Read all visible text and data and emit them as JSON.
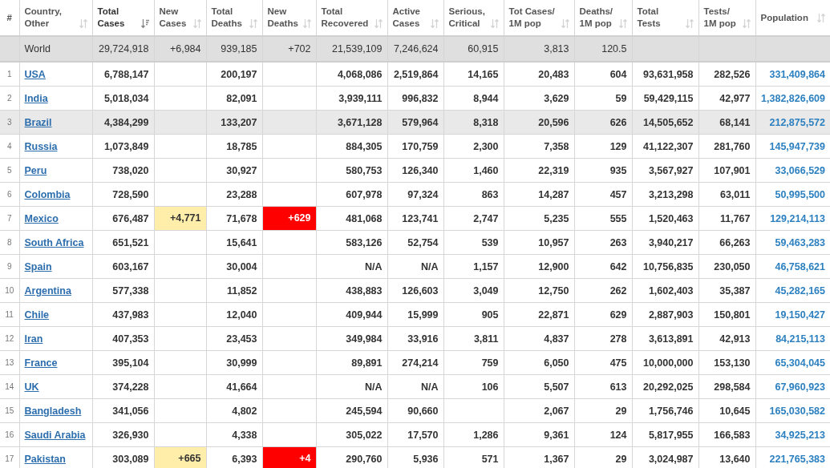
{
  "table": {
    "columns": [
      {
        "label": "#",
        "sortable": false,
        "sorted": false
      },
      {
        "label": "Country,\nOther",
        "sortable": true,
        "sorted": false
      },
      {
        "label": "Total\nCases",
        "sortable": true,
        "sorted": true
      },
      {
        "label": "New\nCases",
        "sortable": true,
        "sorted": false
      },
      {
        "label": "Total\nDeaths",
        "sortable": true,
        "sorted": false
      },
      {
        "label": "New\nDeaths",
        "sortable": true,
        "sorted": false
      },
      {
        "label": "Total\nRecovered",
        "sortable": true,
        "sorted": false
      },
      {
        "label": "Active\nCases",
        "sortable": true,
        "sorted": false
      },
      {
        "label": "Serious,\nCritical",
        "sortable": true,
        "sorted": false
      },
      {
        "label": "Tot Cases/\n1M pop",
        "sortable": true,
        "sorted": false
      },
      {
        "label": "Deaths/\n1M pop",
        "sortable": true,
        "sorted": false
      },
      {
        "label": "Total\nTests",
        "sortable": true,
        "sorted": false
      },
      {
        "label": "Tests/\n1M pop",
        "sortable": true,
        "sorted": false
      },
      {
        "label": "Population",
        "sortable": true,
        "sorted": false
      }
    ],
    "total": {
      "cells": [
        null,
        "World",
        "29,724,918",
        "+6,984",
        "939,185",
        "+702",
        "21,539,109",
        "7,246,624",
        "60,915",
        "3,813",
        "120.5",
        null,
        null,
        null
      ]
    },
    "rows": [
      {
        "highlighted": false,
        "cells": [
          "1",
          "USA",
          "6,788,147",
          null,
          "200,197",
          null,
          "4,068,086",
          "2,519,864",
          "14,165",
          "20,483",
          "604",
          "93,631,958",
          "282,526",
          "331,409,864"
        ]
      },
      {
        "highlighted": false,
        "cells": [
          "2",
          "India",
          "5,018,034",
          null,
          "82,091",
          null,
          "3,939,111",
          "996,832",
          "8,944",
          "3,629",
          "59",
          "59,429,115",
          "42,977",
          "1,382,826,609"
        ]
      },
      {
        "highlighted": true,
        "cells": [
          "3",
          "Brazil",
          "4,384,299",
          null,
          "133,207",
          null,
          "3,671,128",
          "579,964",
          "8,318",
          "20,596",
          "626",
          "14,505,652",
          "68,141",
          "212,875,572"
        ]
      },
      {
        "highlighted": false,
        "cells": [
          "4",
          "Russia",
          "1,073,849",
          null,
          "18,785",
          null,
          "884,305",
          "170,759",
          "2,300",
          "7,358",
          "129",
          "41,122,307",
          "281,760",
          "145,947,739"
        ]
      },
      {
        "highlighted": false,
        "cells": [
          "5",
          "Peru",
          "738,020",
          null,
          "30,927",
          null,
          "580,753",
          "126,340",
          "1,460",
          "22,319",
          "935",
          "3,567,927",
          "107,901",
          "33,066,529"
        ]
      },
      {
        "highlighted": false,
        "cells": [
          "6",
          "Colombia",
          "728,590",
          null,
          "23,288",
          null,
          "607,978",
          "97,324",
          "863",
          "14,287",
          "457",
          "3,213,298",
          "63,011",
          "50,995,500"
        ]
      },
      {
        "highlighted": false,
        "cells": [
          "7",
          "Mexico",
          "676,487",
          "+4,771",
          "71,678",
          "+629",
          "481,068",
          "123,741",
          "2,747",
          "5,235",
          "555",
          "1,520,463",
          "11,767",
          "129,214,113"
        ]
      },
      {
        "highlighted": false,
        "cells": [
          "8",
          "South Africa",
          "651,521",
          null,
          "15,641",
          null,
          "583,126",
          "52,754",
          "539",
          "10,957",
          "263",
          "3,940,217",
          "66,263",
          "59,463,283"
        ]
      },
      {
        "highlighted": false,
        "cells": [
          "9",
          "Spain",
          "603,167",
          null,
          "30,004",
          null,
          "N/A",
          "N/A",
          "1,157",
          "12,900",
          "642",
          "10,756,835",
          "230,050",
          "46,758,621"
        ]
      },
      {
        "highlighted": false,
        "cells": [
          "10",
          "Argentina",
          "577,338",
          null,
          "11,852",
          null,
          "438,883",
          "126,603",
          "3,049",
          "12,750",
          "262",
          "1,602,403",
          "35,387",
          "45,282,165"
        ]
      },
      {
        "highlighted": false,
        "cells": [
          "11",
          "Chile",
          "437,983",
          null,
          "12,040",
          null,
          "409,944",
          "15,999",
          "905",
          "22,871",
          "629",
          "2,887,903",
          "150,801",
          "19,150,427"
        ]
      },
      {
        "highlighted": false,
        "cells": [
          "12",
          "Iran",
          "407,353",
          null,
          "23,453",
          null,
          "349,984",
          "33,916",
          "3,811",
          "4,837",
          "278",
          "3,613,891",
          "42,913",
          "84,215,113"
        ]
      },
      {
        "highlighted": false,
        "cells": [
          "13",
          "France",
          "395,104",
          null,
          "30,999",
          null,
          "89,891",
          "274,214",
          "759",
          "6,050",
          "475",
          "10,000,000",
          "153,130",
          "65,304,045"
        ]
      },
      {
        "highlighted": false,
        "cells": [
          "14",
          "UK",
          "374,228",
          null,
          "41,664",
          null,
          "N/A",
          "N/A",
          "106",
          "5,507",
          "613",
          "20,292,025",
          "298,584",
          "67,960,923"
        ]
      },
      {
        "highlighted": false,
        "cells": [
          "15",
          "Bangladesh",
          "341,056",
          null,
          "4,802",
          null,
          "245,594",
          "90,660",
          null,
          "2,067",
          "29",
          "1,756,746",
          "10,645",
          "165,030,582"
        ]
      },
      {
        "highlighted": false,
        "cells": [
          "16",
          "Saudi Arabia",
          "326,930",
          null,
          "4,338",
          null,
          "305,022",
          "17,570",
          "1,286",
          "9,361",
          "124",
          "5,817,955",
          "166,583",
          "34,925,213"
        ]
      },
      {
        "highlighted": false,
        "cells": [
          "17",
          "Pakistan",
          "303,089",
          "+665",
          "6,393",
          "+4",
          "290,760",
          "5,936",
          "571",
          "1,367",
          "29",
          "3,024,987",
          "13,640",
          "221,765,383"
        ]
      }
    ]
  }
}
